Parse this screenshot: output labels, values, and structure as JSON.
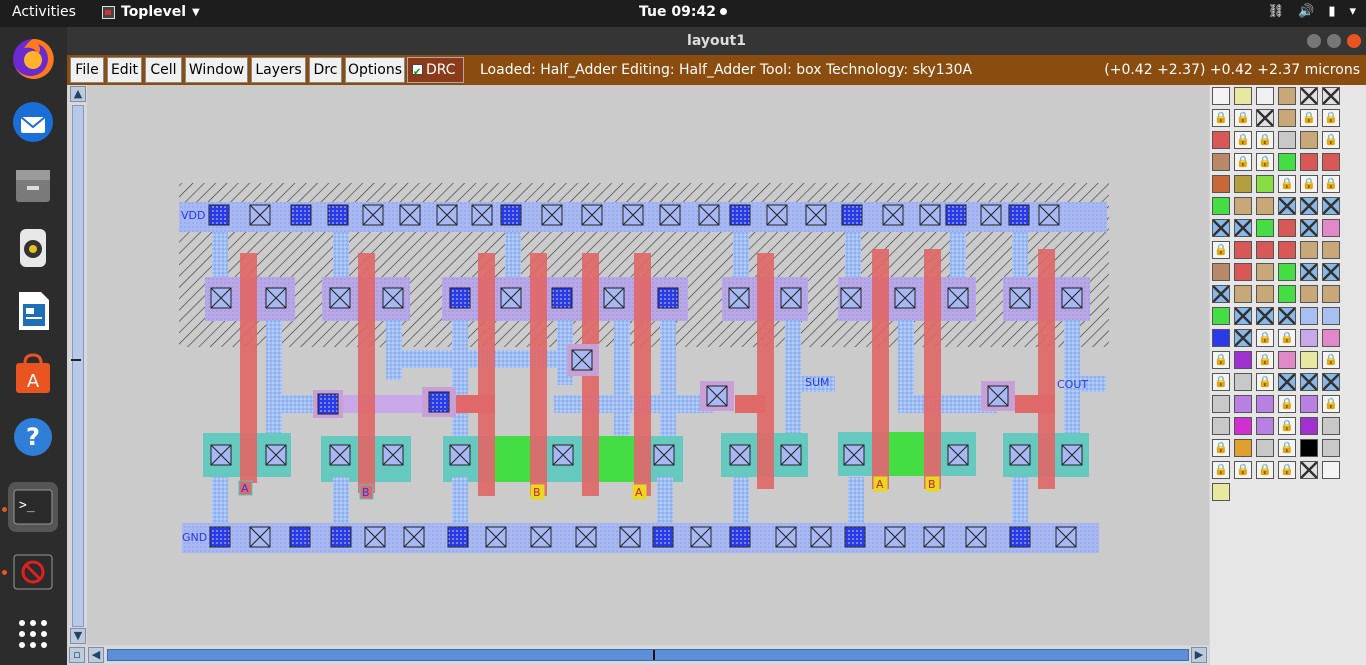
{
  "topbar": {
    "activities": "Activities",
    "app_name": "Toplevel",
    "clock": "Tue 09:42"
  },
  "window": {
    "title": "layout1"
  },
  "menu": {
    "items": [
      "File",
      "Edit",
      "Cell",
      "Window",
      "Layers",
      "Drc",
      "Options"
    ],
    "drc_label": "DRC",
    "drc_checked": true
  },
  "status": {
    "text": "Loaded: Half_Adder Editing: Half_Adder Tool: box  Technology: sky130A",
    "coords": "(+0.42 +2.37) +0.42 +2.37 microns"
  },
  "layout": {
    "labels": {
      "vdd": "VDD",
      "gnd": "GND",
      "sum": "SUM",
      "cout": "COUT",
      "a": "A",
      "b": "B"
    }
  },
  "colors": {
    "menubar": "#8b4c10",
    "metal1": "#a9b9f0",
    "li": "#7f98e8",
    "poly": "#e06868",
    "diff": "#66c9c0",
    "ndiff": "#44dd44",
    "nwell_hatch": "#222222",
    "canvas": "#cbcbcb"
  },
  "dock": [
    "firefox-icon",
    "thunderbird-icon",
    "files-icon",
    "rhythmbox-icon",
    "writer-icon",
    "software-icon",
    "help-icon",
    "terminal-icon",
    "blocked-icon",
    "apps-grid-icon"
  ]
}
